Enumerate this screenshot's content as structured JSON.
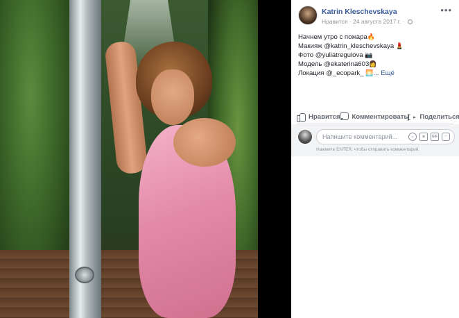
{
  "post": {
    "author": "Katrin Kleschevskaya",
    "meta": "Нравится · 24 августа 2017 г. ·",
    "more_label": "•••",
    "text_lines": [
      {
        "text": "Начнем утро с пожара",
        "emoji": "🔥"
      },
      {
        "text": "Макияж @katrin_klesсhevskaya",
        "emoji": "💄"
      },
      {
        "text": "Фото @yuliatregulova",
        "emoji": "📷"
      },
      {
        "text": "Модель @ekaterina603",
        "emoji": "👩"
      },
      {
        "text": "Локация @_ecopark_",
        "emoji": "🌅"
      }
    ],
    "see_more": "... Ещё"
  },
  "actions": {
    "like": "Нравится",
    "comment": "Комментировать",
    "share": "Поделиться"
  },
  "comment_box": {
    "placeholder": "Напишите комментарий...",
    "hint": "Нажмите ENTER, чтобы отправить комментарий.",
    "tools": [
      "emoji-icon",
      "camera-icon",
      "gif-icon",
      "sticker-icon"
    ]
  },
  "colors": {
    "link": "#365899",
    "muted": "#90949c",
    "panel_bg": "#ffffff",
    "comment_bg": "#f2f3f5"
  }
}
